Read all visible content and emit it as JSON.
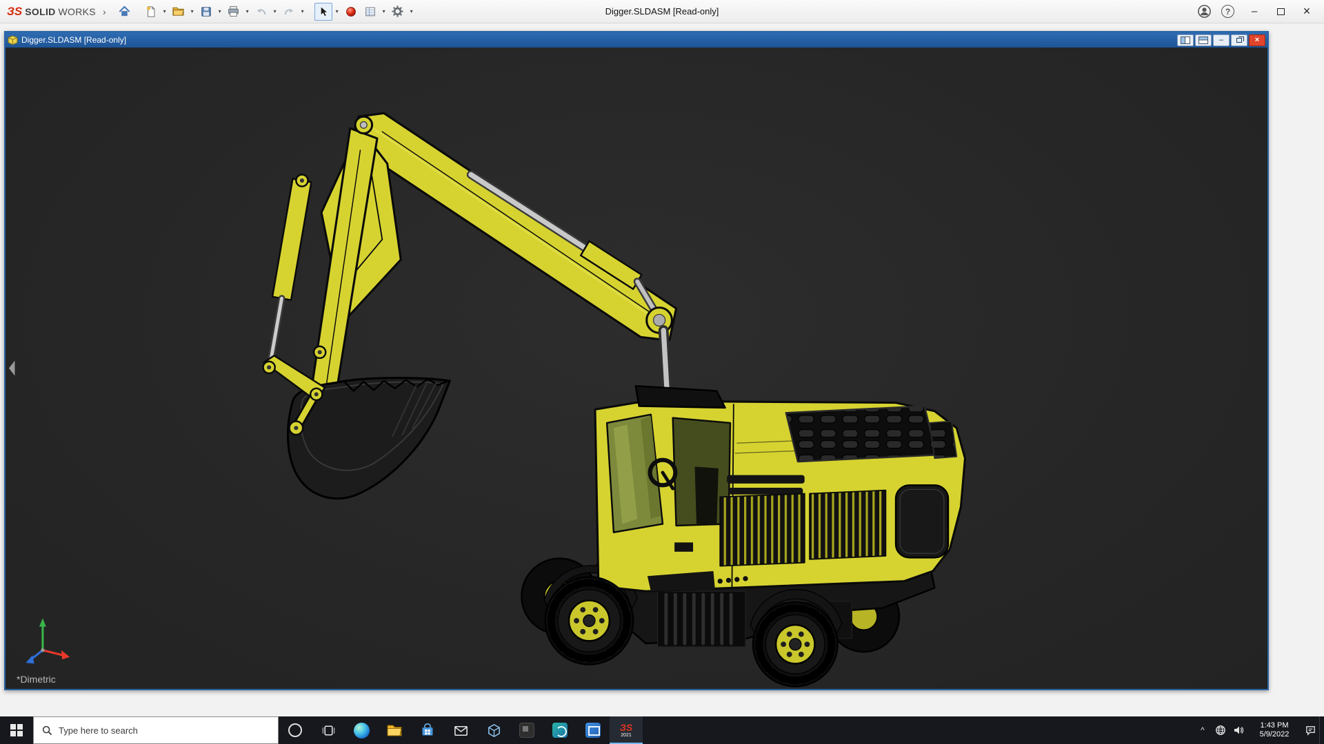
{
  "titlebar": {
    "brand_mark": "ЗS",
    "brand_bold": "SOLID",
    "brand_light": "WORKS",
    "expand_chevron": "›",
    "document_title": "Digger.SLDASM [Read-only]"
  },
  "toolbar": {
    "caret": "▾",
    "items": [
      "home",
      "new-document",
      "open",
      "save",
      "print",
      "undo",
      "redo",
      "select",
      "sphere",
      "drawing-sheet",
      "options-gear"
    ]
  },
  "icons": {
    "minimize": "–",
    "close": "×",
    "help": "?"
  },
  "doc_window": {
    "title": "Digger.SLDASM [Read-only]",
    "view_orientation": "*Dimetric"
  },
  "taskbar": {
    "search_placeholder": "Type here to search",
    "sw_badge_year": "2021",
    "tray": {
      "hidden_icons_glyph": "^",
      "time": "1:43 PM",
      "date": "5/9/2022"
    }
  },
  "colors": {
    "titlebar_blue": "#2a63a4",
    "close_red": "#e0452c",
    "excavator_yellow": "#d6d331",
    "viewport_bg": "#272727",
    "taskbar_bg": "#16181d"
  }
}
